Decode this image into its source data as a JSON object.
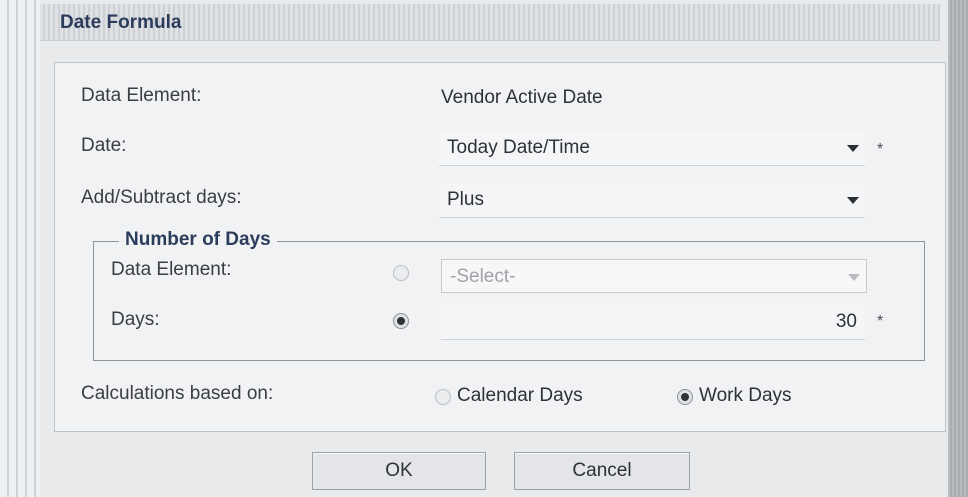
{
  "dialog": {
    "title": "Date Formula"
  },
  "fields": {
    "data_element_label": "Data Element:",
    "data_element_value": "Vendor Active Date",
    "date_label": "Date:",
    "date_value": "Today Date/Time",
    "add_subtract_label": "Add/Subtract days:",
    "add_subtract_value": "Plus",
    "required_marker": "*"
  },
  "number_of_days": {
    "legend": "Number of Days",
    "data_element_label": "Data Element:",
    "data_element_placeholder": "-Select-",
    "days_label": "Days:",
    "days_value": "30",
    "selected_option": "days"
  },
  "calculation": {
    "label": "Calculations based on:",
    "calendar_days_label": "Calendar Days",
    "work_days_label": "Work Days",
    "selected": "work_days"
  },
  "buttons": {
    "ok_label": "OK",
    "cancel_label": "Cancel"
  }
}
